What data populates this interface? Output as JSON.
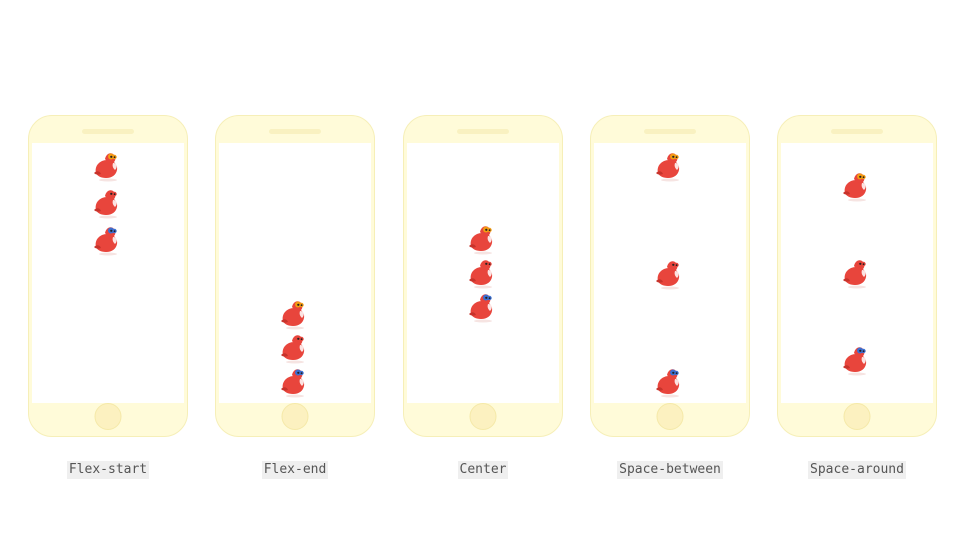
{
  "diagram": {
    "colors": {
      "phone_body": "#fffbd9",
      "screen": "#ffffff",
      "bird_body": "#e8453c",
      "bird_accent_orange": "#f39c12",
      "bird_accent_blue": "#3b6fd1",
      "caption_bg": "#efefef"
    },
    "bird_icon": "red-bird-icon",
    "panels": [
      {
        "label": "Flex-start",
        "justify": "flex-start",
        "accents": [
          "#f39c12",
          "#e8453c",
          "#3b6fd1"
        ]
      },
      {
        "label": "Flex-end",
        "justify": "flex-end",
        "accents": [
          "#f39c12",
          "#e8453c",
          "#3b6fd1"
        ]
      },
      {
        "label": "Center",
        "justify": "center",
        "accents": [
          "#f39c12",
          "#e8453c",
          "#3b6fd1"
        ]
      },
      {
        "label": "Space-between",
        "justify": "space-between",
        "accents": [
          "#f39c12",
          "#e8453c",
          "#3b6fd1"
        ]
      },
      {
        "label": "Space-around",
        "justify": "space-around",
        "accents": [
          "#f39c12",
          "#e8453c",
          "#3b6fd1"
        ]
      }
    ]
  }
}
